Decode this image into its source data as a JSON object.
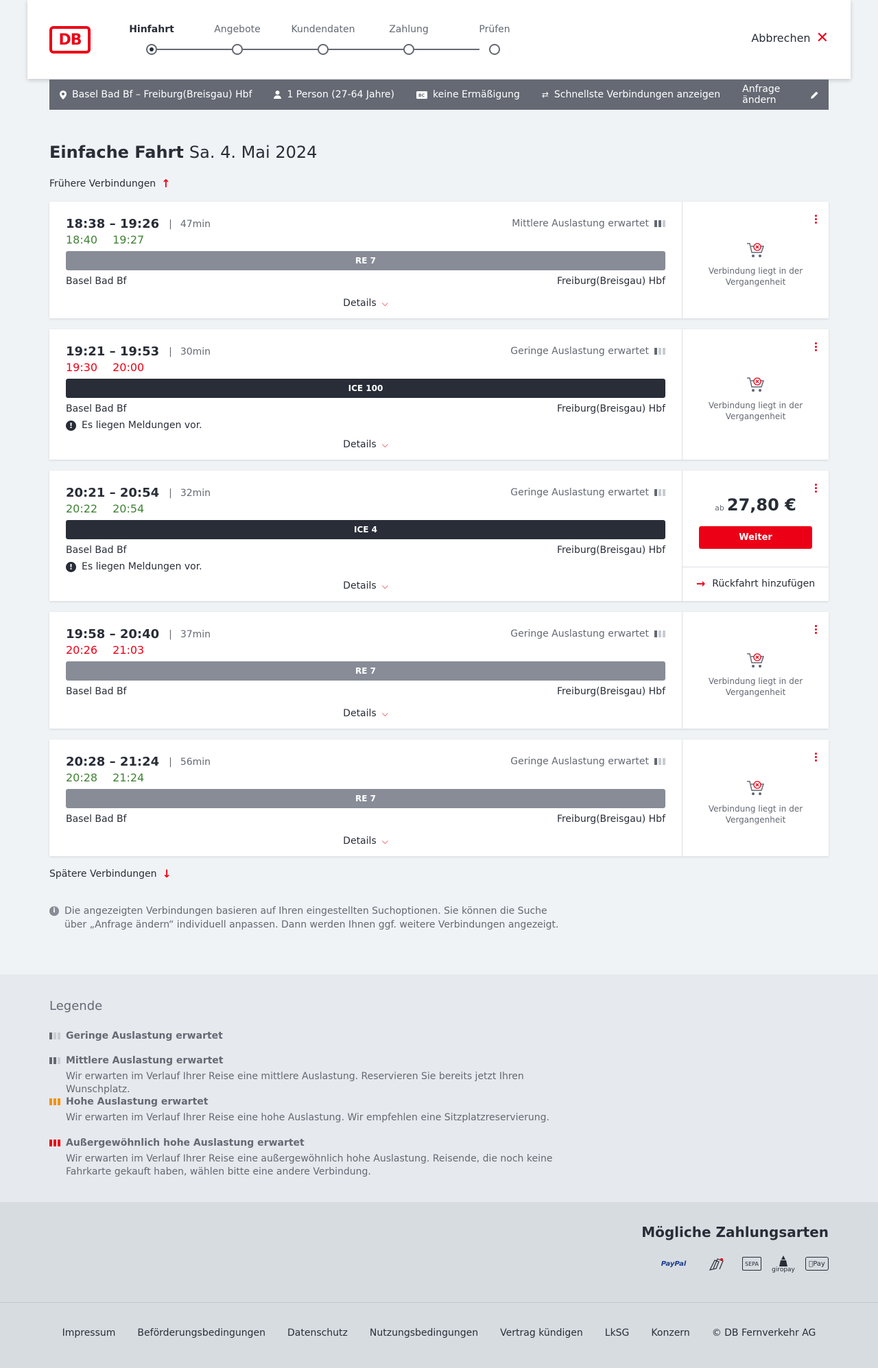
{
  "header": {
    "logo_text": "DB",
    "steps": [
      "Hinfahrt",
      "Angebote",
      "Kundendaten",
      "Zahlung",
      "Prüfen"
    ],
    "active_step": 0,
    "cancel_label": "Abbrechen"
  },
  "searchbar": {
    "route": "Basel Bad Bf – Freiburg(Breisgau) Hbf",
    "passengers": "1 Person (27-64 Jahre)",
    "discount": "keine Ermäßigung",
    "fastest": "Schnellste Verbindungen anzeigen",
    "change": "Anfrage ändern"
  },
  "title": {
    "main": "Einfache Fahrt",
    "date": "Sa. 4. Mai 2024"
  },
  "earlier_label": "Frühere Verbindungen",
  "later_label": "Spätere Verbindungen",
  "details_label": "Details",
  "past_label": "Verbindung liegt in der Vergangenheit",
  "message_label": "Es liegen Meldungen vor.",
  "connections": [
    {
      "times": "18:38 – 19:26",
      "duration": "47min",
      "rt_dep": "18:40",
      "rt_arr": "19:27",
      "rt_status": "ok",
      "load": "Mittlere Auslastung erwartet",
      "train": "RE 7",
      "train_type": "re",
      "from": "Basel Bad Bf",
      "to": "Freiburg(Breisgau) Hbf",
      "message": false,
      "bookable": false
    },
    {
      "times": "19:21 – 19:53",
      "duration": "30min",
      "rt_dep": "19:30",
      "rt_arr": "20:00",
      "rt_status": "late",
      "load": "Geringe Auslastung erwartet",
      "train": "ICE 100",
      "train_type": "ice",
      "from": "Basel Bad Bf",
      "to": "Freiburg(Breisgau) Hbf",
      "message": true,
      "bookable": false
    },
    {
      "times": "20:21 – 20:54",
      "duration": "32min",
      "rt_dep": "20:22",
      "rt_arr": "20:54",
      "rt_status": "ok",
      "load": "Geringe Auslastung erwartet",
      "train": "ICE 4",
      "train_type": "ice",
      "from": "Basel Bad Bf",
      "to": "Freiburg(Breisgau) Hbf",
      "message": true,
      "bookable": true,
      "price_prefix": "ab",
      "price": "27,80 €",
      "cta": "Weiter",
      "return_label": "Rückfahrt hinzufügen"
    },
    {
      "times": "19:58 – 20:40",
      "duration": "37min",
      "rt_dep": "20:26",
      "rt_arr": "21:03",
      "rt_status": "late",
      "load": "Geringe Auslastung erwartet",
      "train": "RE 7",
      "train_type": "re",
      "from": "Basel Bad Bf",
      "to": "Freiburg(Breisgau) Hbf",
      "message": false,
      "bookable": false
    },
    {
      "times": "20:28 – 21:24",
      "duration": "56min",
      "rt_dep": "20:28",
      "rt_arr": "21:24",
      "rt_status": "ok",
      "load": "Geringe Auslastung erwartet",
      "train": "RE 7",
      "train_type": "re",
      "from": "Basel Bad Bf",
      "to": "Freiburg(Breisgau) Hbf",
      "message": false,
      "bookable": false
    }
  ],
  "info_text": "Die angezeigten Verbindungen basieren auf Ihren eingestellten Suchoptionen. Sie können die Suche über „Anfrage ändern“ individuell anpassen. Dann werden Ihnen ggf. weitere Verbindungen angezeigt.",
  "legend": {
    "title": "Legende",
    "items": [
      {
        "title": "Geringe Auslastung erwartet",
        "desc": ""
      },
      {
        "title": "Mittlere Auslastung erwartet",
        "desc": "Wir erwarten im Verlauf Ihrer Reise eine mittlere Auslastung. Reservieren Sie bereits jetzt Ihren Wunschplatz."
      },
      {
        "title": "Hohe Auslastung erwartet",
        "desc": "Wir erwarten im Verlauf Ihrer Reise eine hohe Auslastung. Wir empfehlen eine Sitzplatzreservierung."
      },
      {
        "title": "Außergewöhnlich hohe Auslastung erwartet",
        "desc": "Wir erwarten im Verlauf Ihrer Reise eine außergewöhnlich hohe Auslastung. Reisende, die noch keine Fahrkarte gekauft haben, wählen bitte eine andere Verbindung."
      }
    ]
  },
  "payment": {
    "title": "Mögliche Zahlungsarten",
    "methods": [
      "PayPal",
      "Kreditkarte",
      "SEPA",
      "giropay",
      "Pay"
    ]
  },
  "footer": [
    "Impressum",
    "Beförderungsbedingungen",
    "Datenschutz",
    "Nutzungsbedingungen",
    "Vertrag kündigen",
    "LkSG",
    "Konzern",
    "© DB Fernverkehr AG"
  ],
  "colors": {
    "db_red": "#ec0016",
    "on_time": "#408335",
    "delay": "#ec0016",
    "ice_bar": "#282d37",
    "re_bar": "#878c96"
  }
}
